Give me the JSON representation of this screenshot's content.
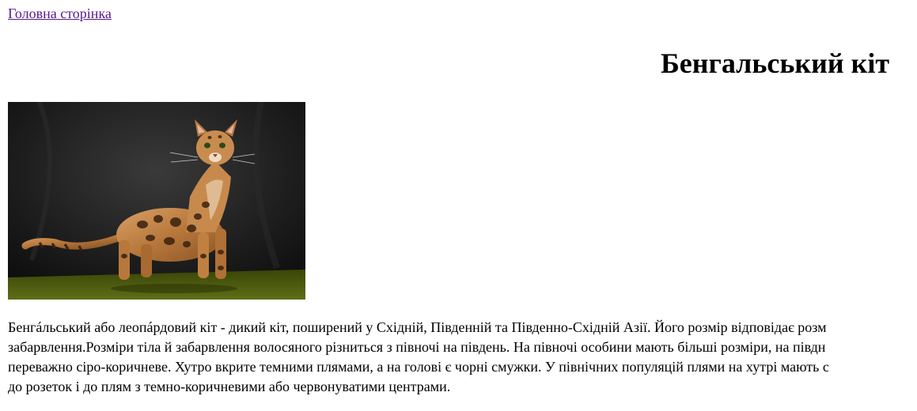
{
  "nav": {
    "home_link": "Головна сторінка"
  },
  "header": {
    "title": "Бенгальський кіт"
  },
  "image": {
    "subject": "bengal-cat-photo"
  },
  "article": {
    "lines": [
      "Бенгáльський або леопáрдовий кіт - дикий кіт, поширений у Східній, Південній та Південно-Східній Азії. Його розмір відповідає розм",
      "забарвлення.Розміри тіла й забарвлення волосяного різниться з півночі на південь. На півночі особини мають більші розміри, на півдн",
      "переважно сіро-коричневе. Хутро вкрите темними плямами, а на голові є чорні смужки. У північних популяцій плями на хутрі мають с",
      "до розеток і до плям з темно-коричневими або червонуватими центрами."
    ]
  },
  "colors": {
    "link_visited": "#551a8b",
    "text": "#000000",
    "background": "#ffffff",
    "photo_backdrop": "#1a1a1a",
    "photo_floor": "#4a5a10"
  }
}
